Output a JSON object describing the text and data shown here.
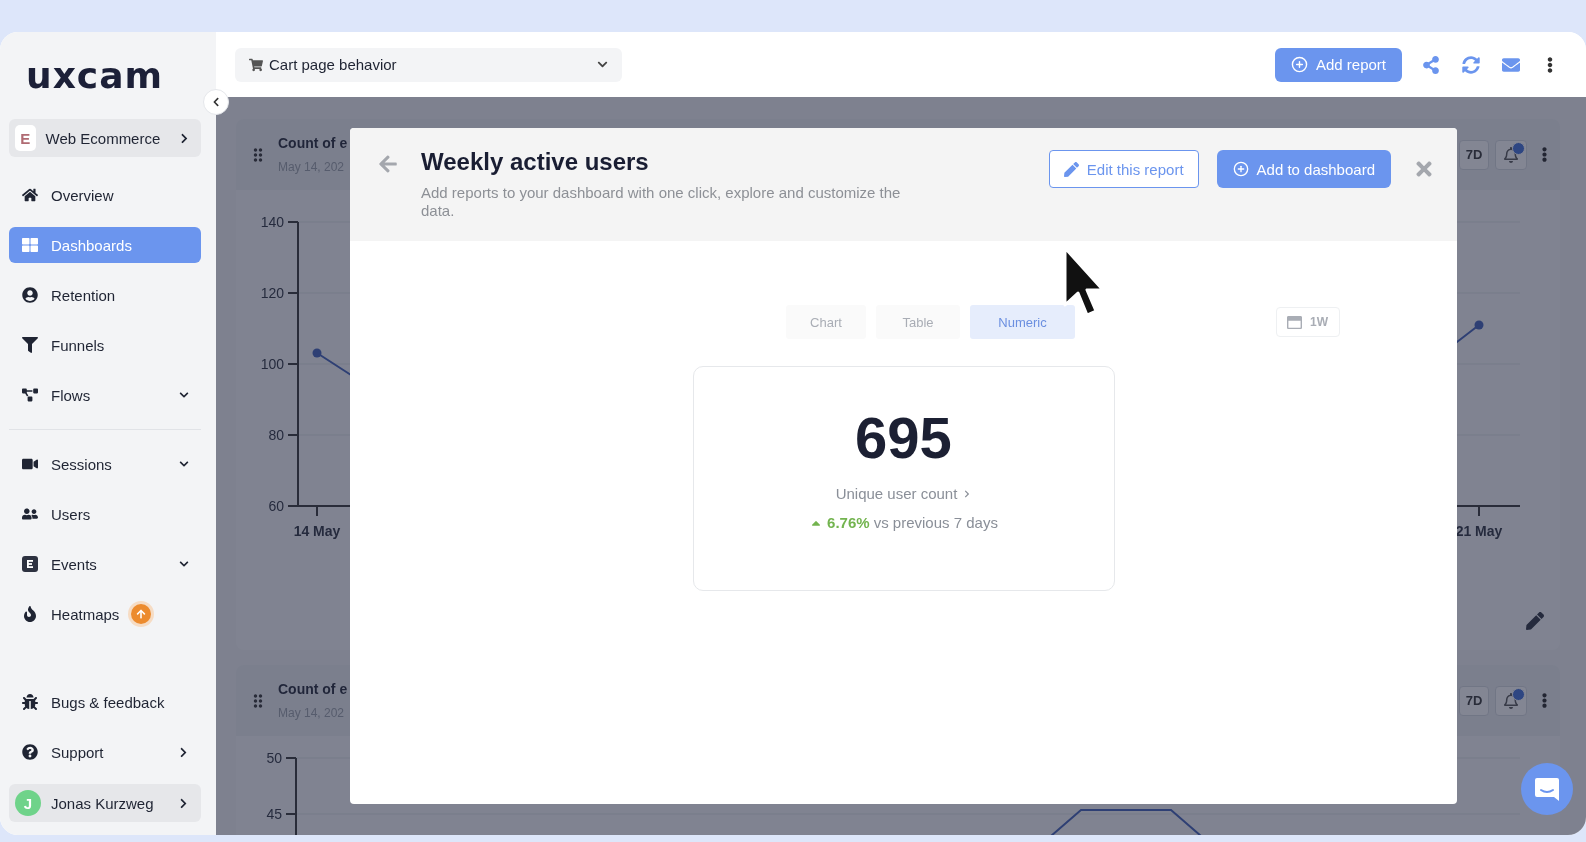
{
  "logo": {
    "text": "uxcam"
  },
  "sidebar": {
    "workspace": {
      "initial": "E",
      "name": "Web Ecommerce"
    },
    "nav_groups": [
      [
        {
          "label": "Overview",
          "selected": false
        },
        {
          "label": "Dashboards",
          "selected": true
        },
        {
          "label": "Retention",
          "selected": false
        },
        {
          "label": "Funnels",
          "selected": false
        },
        {
          "label": "Flows",
          "selected": false,
          "expandable": true
        }
      ],
      [
        {
          "label": "Sessions",
          "selected": false,
          "expandable": true
        },
        {
          "label": "Users",
          "selected": false
        },
        {
          "label": "Events",
          "selected": false,
          "expandable": true
        },
        {
          "label": "Heatmaps",
          "selected": false,
          "upgrade_badge": true
        }
      ]
    ],
    "footer": [
      {
        "label": "Bugs & feedback",
        "selected": false
      },
      {
        "label": "Support",
        "selected": false,
        "submenu": true
      }
    ],
    "user": {
      "initial": "J",
      "name": "Jonas Kurzweg"
    }
  },
  "topbar": {
    "dashboard_select": {
      "value": "Cart page behavior"
    },
    "add_report": "Add report"
  },
  "dashboard_cards": [
    {
      "title": "Count of e",
      "date": "May 14, 202",
      "range": "7D",
      "y_labels": [
        "140",
        "120",
        "100",
        "80",
        "60"
      ],
      "x_labels": [
        "14 May",
        "21 May"
      ]
    },
    {
      "title": "Count of e",
      "date": "May 14, 202",
      "range": "7D",
      "y_labels": [
        "50",
        "45"
      ]
    }
  ],
  "modal": {
    "title": "Weekly active users",
    "subtitle": "Add reports to your dashboard with one click, explore and customize the data.",
    "edit_button": "Edit this report",
    "add_button": "Add to dashboard",
    "view_tabs": [
      {
        "label": "Chart",
        "selected": false
      },
      {
        "label": "Table",
        "selected": false
      },
      {
        "label": "Numeric",
        "selected": true
      }
    ],
    "date_range": "1W",
    "metric": {
      "value": "695",
      "label": "Unique user count",
      "trend_up": true,
      "change": "6.76%",
      "comparison": "vs previous 7 days"
    }
  }
}
